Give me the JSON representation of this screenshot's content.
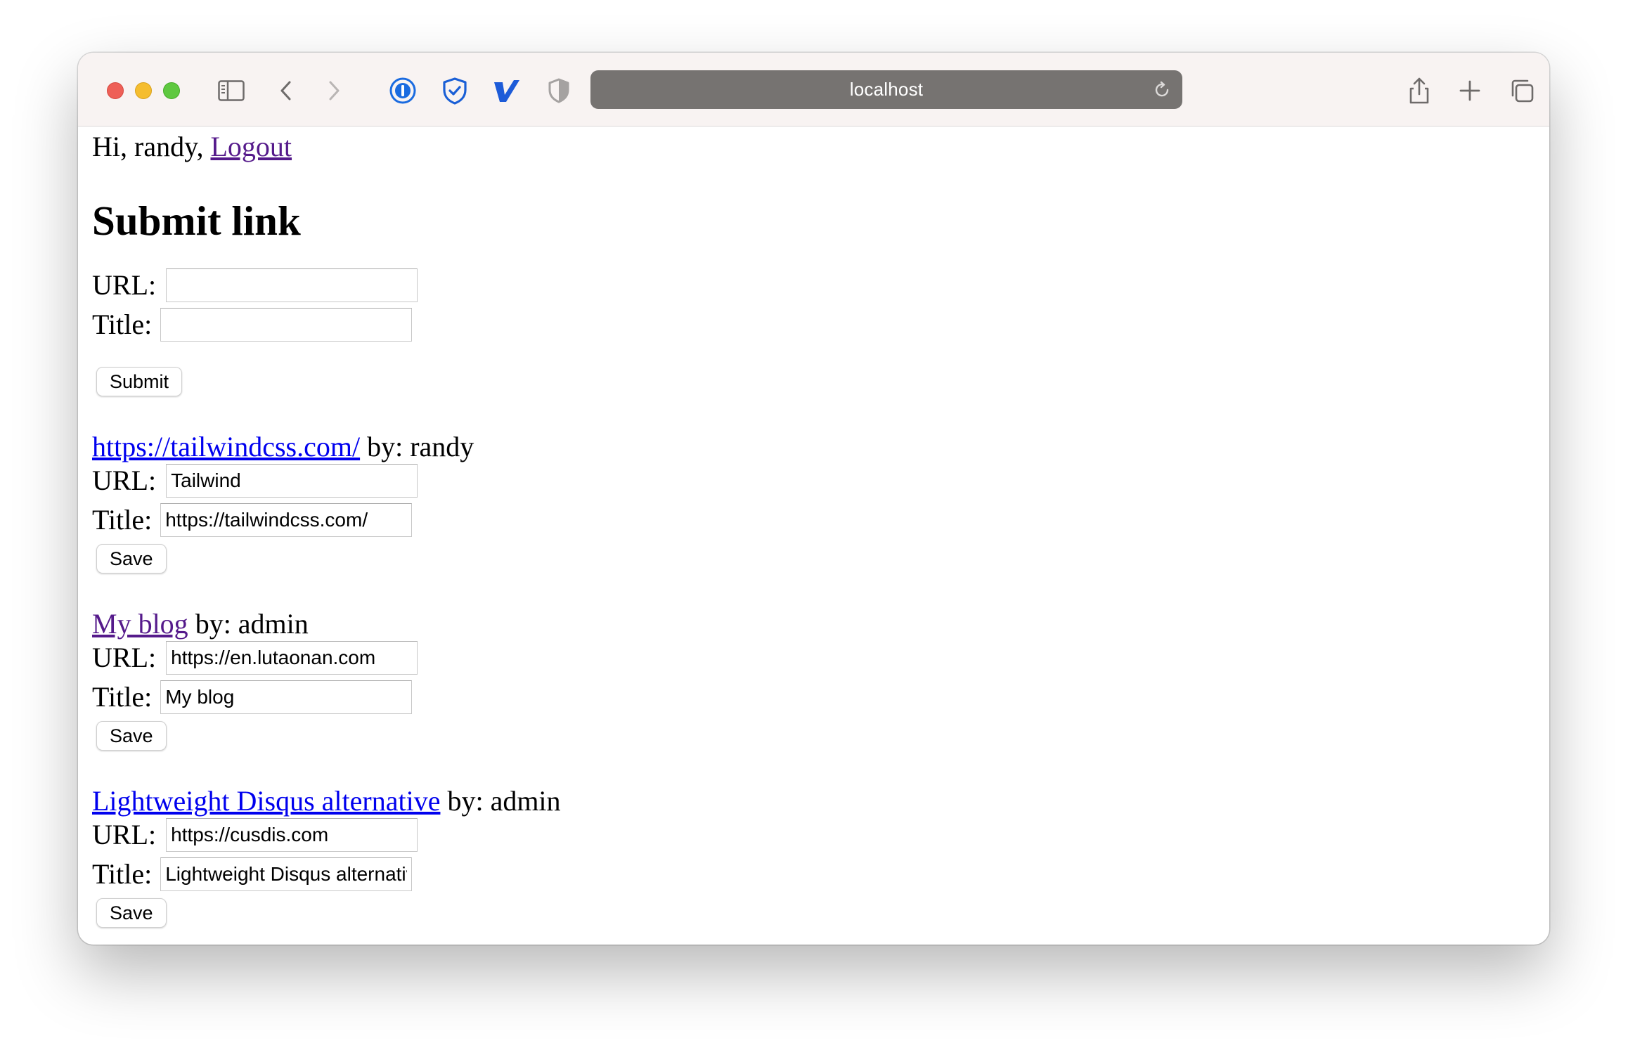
{
  "browser": {
    "url": "localhost",
    "icons": {
      "sidebar": "sidebar-icon",
      "back": "chevron-left-icon",
      "forward": "chevron-right-icon",
      "ext1": "1password-icon",
      "ext2": "shield-check-icon",
      "ext3": "vimeo-v-icon",
      "ext4": "privacy-shield-icon",
      "reload": "reload-icon",
      "share": "share-icon",
      "newtab": "plus-icon",
      "tabs": "tab-overview-icon"
    }
  },
  "header": {
    "greeting": "Hi, randy, ",
    "logout_label": "Logout"
  },
  "submit_form": {
    "title": "Submit link",
    "url_label": "URL:",
    "url_value": "",
    "title_label": "Title:",
    "title_value": "",
    "submit_label": "Submit"
  },
  "links": [
    {
      "link_text": "https://tailwindcss.com/",
      "by_text": " by: randy",
      "url_label": "URL:",
      "url_value": "Tailwind",
      "title_label": "Title:",
      "title_value": "https://tailwindcss.com/",
      "save_label": "Save"
    },
    {
      "link_text": "My blog",
      "by_text": " by: admin",
      "url_label": "URL:",
      "url_value": "https://en.lutaonan.com",
      "title_label": "Title:",
      "title_value": "My blog",
      "save_label": "Save"
    },
    {
      "link_text": "Lightweight Disqus alternative",
      "by_text": " by: admin",
      "url_label": "URL:",
      "url_value": "https://cusdis.com",
      "title_label": "Title:",
      "title_value": "Lightweight Disqus alternative",
      "save_label": "Save"
    }
  ]
}
